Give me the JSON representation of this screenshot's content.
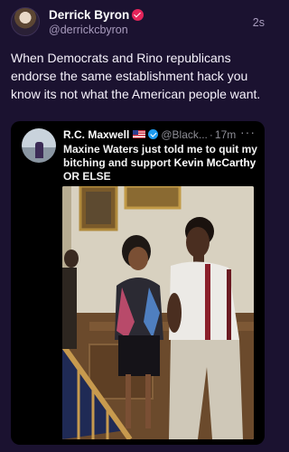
{
  "post": {
    "author_name": "Derrick Byron",
    "author_handle": "@derrickcbyron",
    "timestamp": "2s",
    "text": "When Democrats and Rino republicans endorse the same establishment hack you know its not what the American people want.",
    "badge_color": "#e4245a"
  },
  "quoted_post": {
    "author_name": "R.C. Maxwell",
    "author_handle": "@Black...",
    "separator": "·",
    "timestamp": "17m",
    "text_part1": "Maxine Waters just told me to quit my bitching and support ",
    "text_highlight": "Kevin McCarthy",
    "text_part2": " OR ELSE",
    "more_icon": "ellipsis-icon",
    "verified_color": "#1d9bf0"
  },
  "theme": {
    "background": "#1b1230",
    "secondary_text": "#a89bbd"
  }
}
